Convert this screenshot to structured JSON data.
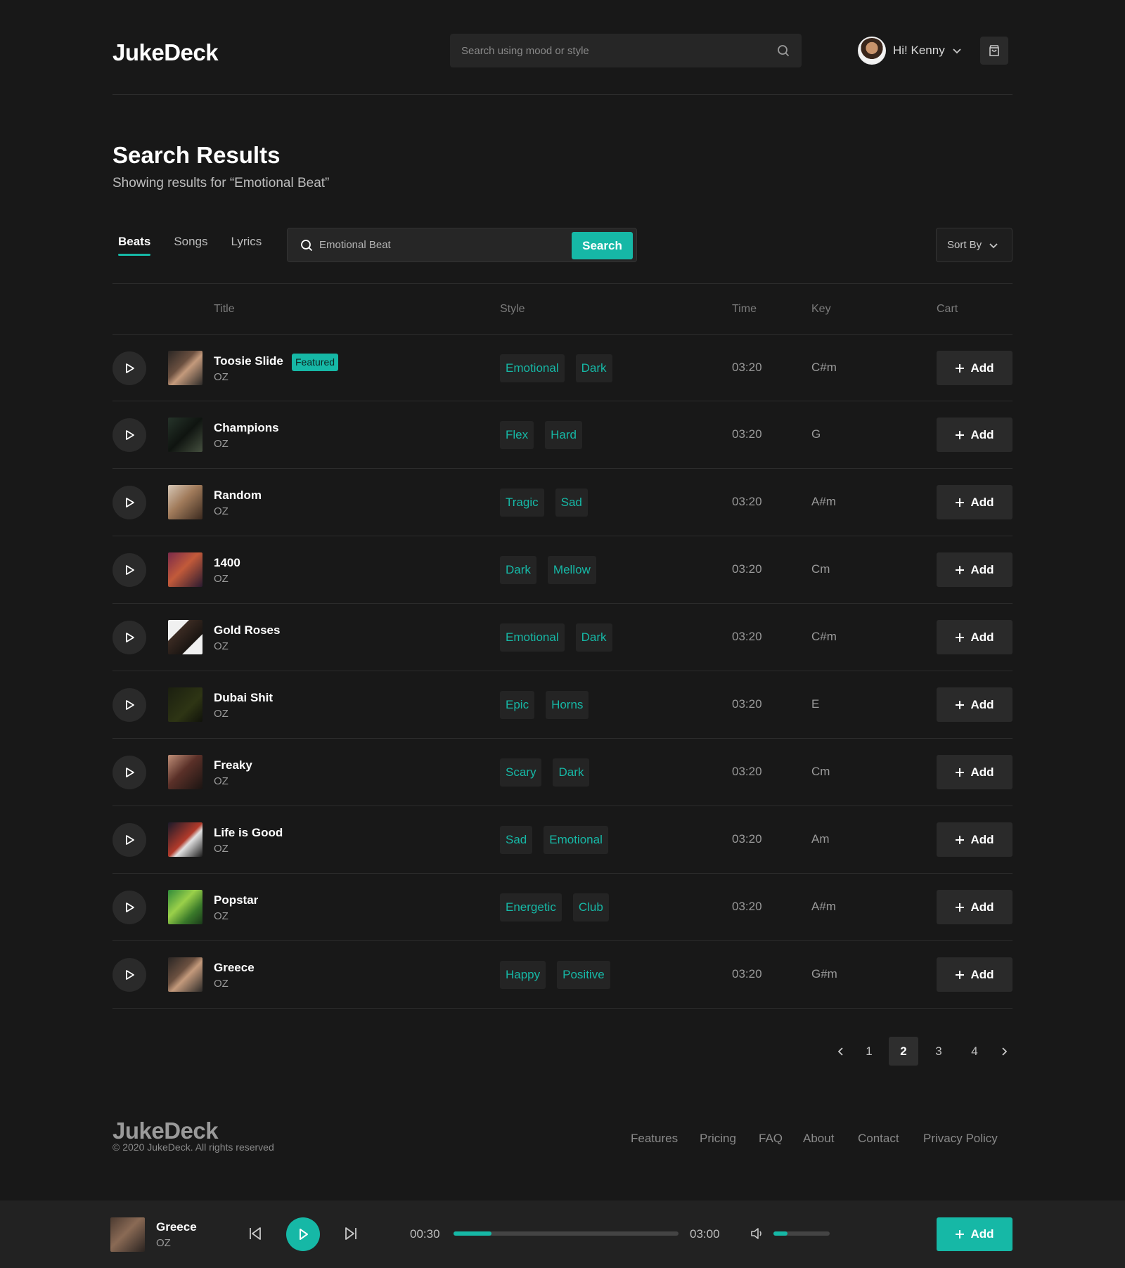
{
  "app": {
    "logo": "JukeDeck"
  },
  "header": {
    "search_placeholder": "Search using mood or style",
    "user_greeting": "Hi! Kenny"
  },
  "page": {
    "title": "Search Results",
    "subtitle": "Showing results for “Emotional Beat”"
  },
  "tabs": [
    {
      "label": "Beats",
      "active": true
    },
    {
      "label": "Songs",
      "active": false
    },
    {
      "label": "Lyrics",
      "active": false
    }
  ],
  "search": {
    "value": "Emotional Beat",
    "button_label": "Search"
  },
  "sort": {
    "label": "Sort By"
  },
  "table": {
    "columns": {
      "title": "Title",
      "style": "Style",
      "time": "Time",
      "key": "Key",
      "cart": "Cart"
    },
    "add_label": "Add",
    "featured_label": "Featured",
    "rows": [
      {
        "title": "Toosie Slide",
        "artist": "OZ",
        "featured": true,
        "tags": [
          "Emotional",
          "Dark"
        ],
        "time": "03:20",
        "key": "C#m"
      },
      {
        "title": "Champions",
        "artist": "OZ",
        "featured": false,
        "tags": [
          "Flex",
          "Hard"
        ],
        "time": "03:20",
        "key": "G"
      },
      {
        "title": "Random",
        "artist": "OZ",
        "featured": false,
        "tags": [
          "Tragic",
          "Sad"
        ],
        "time": "03:20",
        "key": "A#m"
      },
      {
        "title": "1400",
        "artist": "OZ",
        "featured": false,
        "tags": [
          "Dark",
          "Mellow"
        ],
        "time": "03:20",
        "key": "Cm"
      },
      {
        "title": "Gold Roses",
        "artist": "OZ",
        "featured": false,
        "tags": [
          "Emotional",
          "Dark"
        ],
        "time": "03:20",
        "key": "C#m"
      },
      {
        "title": "Dubai Shit",
        "artist": "OZ",
        "featured": false,
        "tags": [
          "Epic",
          "Horns"
        ],
        "time": "03:20",
        "key": "E"
      },
      {
        "title": "Freaky",
        "artist": "OZ",
        "featured": false,
        "tags": [
          "Scary",
          "Dark"
        ],
        "time": "03:20",
        "key": "Cm"
      },
      {
        "title": "Life is Good",
        "artist": "OZ",
        "featured": false,
        "tags": [
          "Sad",
          "Emotional"
        ],
        "time": "03:20",
        "key": "Am"
      },
      {
        "title": "Popstar",
        "artist": "OZ",
        "featured": false,
        "tags": [
          "Energetic",
          "Club"
        ],
        "time": "03:20",
        "key": "A#m"
      },
      {
        "title": "Greece",
        "artist": "OZ",
        "featured": false,
        "tags": [
          "Happy",
          "Positive"
        ],
        "time": "03:20",
        "key": "G#m"
      }
    ]
  },
  "pagination": {
    "pages": [
      "1",
      "2",
      "3",
      "4"
    ],
    "current": "2"
  },
  "footer": {
    "logo": "JukeDeck",
    "copyright": "© 2020 JukeDeck. All rights reserved",
    "links": [
      "Features",
      "Pricing",
      "FAQ",
      "About",
      "Contact",
      "Privacy Policy"
    ]
  },
  "player": {
    "title": "Greece",
    "artist": "OZ",
    "current_time": "00:30",
    "duration": "03:00",
    "progress": 0.17,
    "volume": 0.25,
    "add_label": "Add"
  },
  "colors": {
    "accent": "#16b8a6",
    "background": "#181818",
    "surface": "#2a2a2a"
  },
  "icons": [
    "search-icon",
    "chevron-down-icon",
    "shopping-bag-icon",
    "play-icon",
    "plus-icon",
    "chevron-left-icon",
    "chevron-right-icon",
    "skip-back-icon",
    "skip-forward-icon",
    "volume-icon"
  ]
}
